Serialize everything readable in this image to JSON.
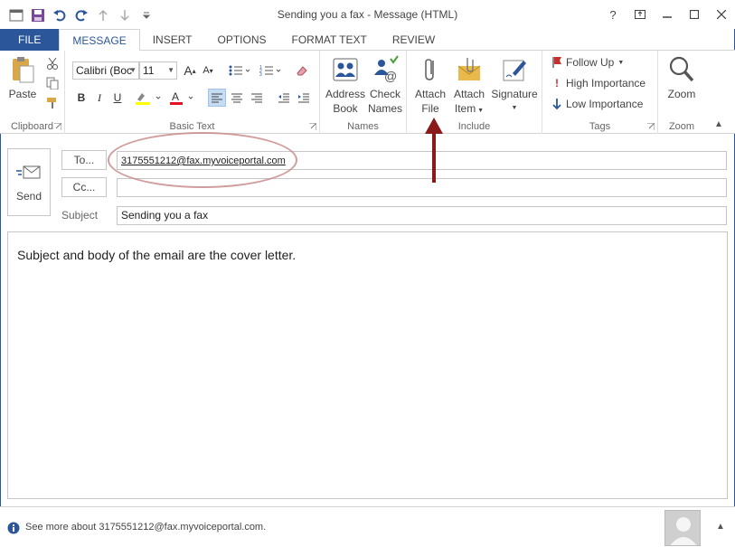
{
  "window": {
    "title": "Sending you a fax - Message (HTML)"
  },
  "tabs": [
    "FILE",
    "MESSAGE",
    "INSERT",
    "OPTIONS",
    "FORMAT TEXT",
    "REVIEW"
  ],
  "ribbon": {
    "clipboard": {
      "label": "Clipboard",
      "paste": "Paste"
    },
    "basic_text": {
      "label": "Basic Text",
      "font_name": "Calibri (Boc",
      "font_size": "11"
    },
    "names": {
      "label": "Names",
      "address_book_1": "Address",
      "address_book_2": "Book",
      "check_names_1": "Check",
      "check_names_2": "Names"
    },
    "include": {
      "label": "Include",
      "attach_file_1": "Attach",
      "attach_file_2": "File",
      "attach_item_1": "Attach",
      "attach_item_2": "Item",
      "signature": "Signature"
    },
    "tags": {
      "label": "Tags",
      "follow_up": "Follow Up",
      "high_importance": "High Importance",
      "low_importance": "Low Importance"
    },
    "zoom": {
      "label": "Zoom",
      "zoom": "Zoom"
    }
  },
  "compose": {
    "send_label": "Send",
    "to_button": "To...",
    "cc_button": "Cc...",
    "subject_label": "Subject",
    "to_value": "3175551212@fax.myvoiceportal.com",
    "cc_value": "",
    "subject_value": "Sending you a fax",
    "body_text": "Subject and body of the email are the cover letter."
  },
  "footer": {
    "see_more": "See more about 3175551212@fax.myvoiceportal.com."
  },
  "colors": {
    "accent": "#2b579a",
    "annotation_arrow": "#8b1a1a",
    "annotation_oval": "#c98b8b"
  }
}
